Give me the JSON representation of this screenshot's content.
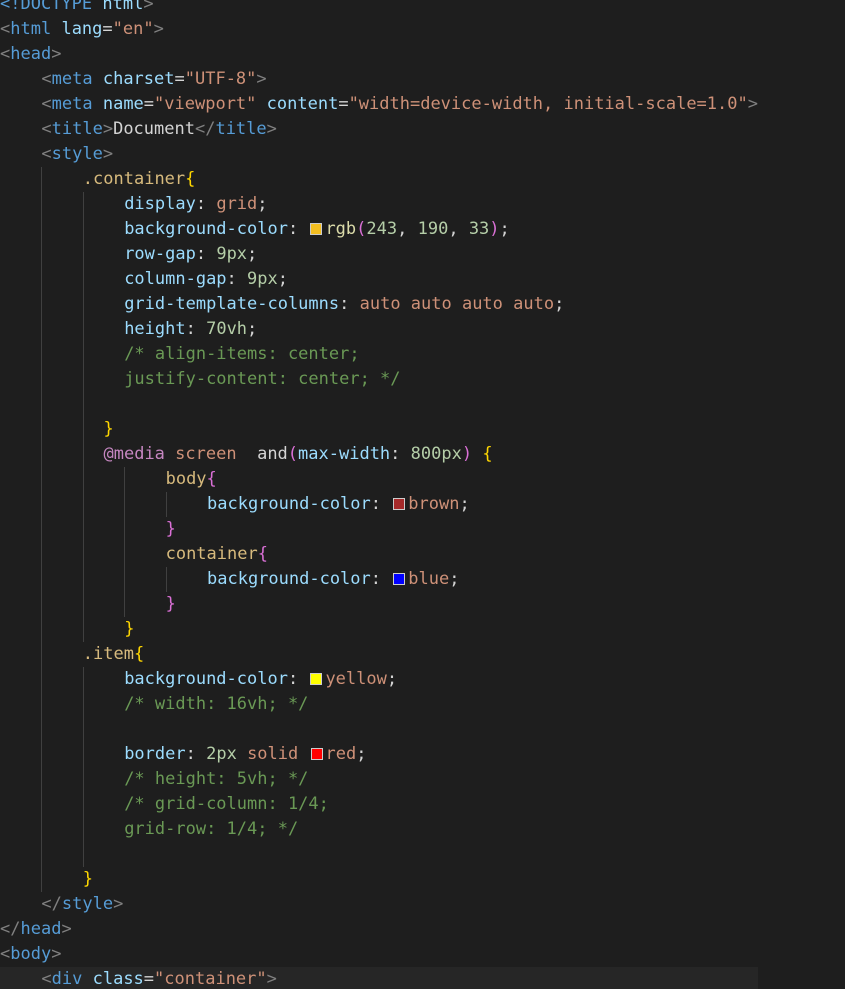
{
  "editor": {
    "language": "html",
    "theme": "dark",
    "current_line": 39,
    "lines": [
      {
        "indent": 0,
        "guides": [],
        "tokens": [
          [
            "<!",
            "tag"
          ],
          [
            "DOCTYPE",
            "tag"
          ],
          [
            " ",
            "text"
          ],
          [
            "html",
            "attr"
          ],
          [
            ">",
            "punc"
          ]
        ]
      },
      {
        "indent": 0,
        "guides": [],
        "tokens": [
          [
            "<",
            "punc"
          ],
          [
            "html",
            "tag"
          ],
          [
            " ",
            "text"
          ],
          [
            "lang",
            "attr"
          ],
          [
            "=",
            "text"
          ],
          [
            "\"en\"",
            "str"
          ],
          [
            ">",
            "punc"
          ]
        ]
      },
      {
        "indent": 0,
        "guides": [],
        "tokens": [
          [
            "<",
            "punc"
          ],
          [
            "head",
            "tag"
          ],
          [
            ">",
            "punc"
          ]
        ]
      },
      {
        "indent": 4,
        "guides": [],
        "tokens": [
          [
            "<",
            "punc"
          ],
          [
            "meta",
            "tag"
          ],
          [
            " ",
            "text"
          ],
          [
            "charset",
            "attr"
          ],
          [
            "=",
            "text"
          ],
          [
            "\"UTF-8\"",
            "str"
          ],
          [
            ">",
            "punc"
          ]
        ]
      },
      {
        "indent": 4,
        "guides": [],
        "tokens": [
          [
            "<",
            "punc"
          ],
          [
            "meta",
            "tag"
          ],
          [
            " ",
            "text"
          ],
          [
            "name",
            "attr"
          ],
          [
            "=",
            "text"
          ],
          [
            "\"viewport\"",
            "str"
          ],
          [
            " ",
            "text"
          ],
          [
            "content",
            "attr"
          ],
          [
            "=",
            "text"
          ],
          [
            "\"width=device-width, initial-scale=1.0\"",
            "str"
          ],
          [
            ">",
            "punc"
          ]
        ]
      },
      {
        "indent": 4,
        "guides": [],
        "tokens": [
          [
            "<",
            "punc"
          ],
          [
            "title",
            "tag"
          ],
          [
            ">",
            "punc"
          ],
          [
            "Document",
            "text"
          ],
          [
            "</",
            "punc"
          ],
          [
            "title",
            "tag"
          ],
          [
            ">",
            "punc"
          ]
        ]
      },
      {
        "indent": 4,
        "guides": [],
        "tokens": [
          [
            "<",
            "punc"
          ],
          [
            "style",
            "tag"
          ],
          [
            ">",
            "punc"
          ]
        ]
      },
      {
        "indent": 8,
        "guides": [
          4
        ],
        "tokens": [
          [
            ".container",
            "sel"
          ],
          [
            "{",
            "b1"
          ]
        ]
      },
      {
        "indent": 12,
        "guides": [
          4,
          8
        ],
        "tokens": [
          [
            "display",
            "prop"
          ],
          [
            ": ",
            "text"
          ],
          [
            "grid",
            "val"
          ],
          [
            ";",
            "text"
          ]
        ]
      },
      {
        "indent": 12,
        "guides": [
          4,
          8
        ],
        "tokens": [
          [
            "background-color",
            "prop"
          ],
          [
            ": ",
            "text"
          ],
          [
            "#f3be21",
            "swatch"
          ],
          [
            "rgb",
            "fn"
          ],
          [
            "(",
            "b2"
          ],
          [
            "243",
            "num"
          ],
          [
            ", ",
            "text"
          ],
          [
            "190",
            "num"
          ],
          [
            ", ",
            "text"
          ],
          [
            "33",
            "num"
          ],
          [
            ")",
            "b2"
          ],
          [
            ";",
            "text"
          ]
        ]
      },
      {
        "indent": 12,
        "guides": [
          4,
          8
        ],
        "tokens": [
          [
            "row-gap",
            "prop"
          ],
          [
            ": ",
            "text"
          ],
          [
            "9px",
            "num"
          ],
          [
            ";",
            "text"
          ]
        ]
      },
      {
        "indent": 12,
        "guides": [
          4,
          8
        ],
        "tokens": [
          [
            "column-gap",
            "prop"
          ],
          [
            ": ",
            "text"
          ],
          [
            "9px",
            "num"
          ],
          [
            ";",
            "text"
          ]
        ]
      },
      {
        "indent": 12,
        "guides": [
          4,
          8
        ],
        "tokens": [
          [
            "grid-template-columns",
            "prop"
          ],
          [
            ": ",
            "text"
          ],
          [
            "auto auto auto auto",
            "val"
          ],
          [
            ";",
            "text"
          ]
        ]
      },
      {
        "indent": 12,
        "guides": [
          4,
          8
        ],
        "tokens": [
          [
            "height",
            "prop"
          ],
          [
            ": ",
            "text"
          ],
          [
            "70vh",
            "num"
          ],
          [
            ";",
            "text"
          ]
        ]
      },
      {
        "indent": 12,
        "guides": [
          4,
          8
        ],
        "tokens": [
          [
            "/* align-items: center;",
            "com"
          ]
        ]
      },
      {
        "indent": 12,
        "guides": [
          4,
          8
        ],
        "tokens": [
          [
            "justify-content: center; */",
            "com"
          ]
        ]
      },
      {
        "indent": 0,
        "guides": [
          4,
          8
        ],
        "tokens": []
      },
      {
        "indent": 10,
        "guides": [
          4,
          8
        ],
        "tokens": [
          [
            "}",
            "b1"
          ]
        ]
      },
      {
        "indent": 10,
        "guides": [
          4,
          8
        ],
        "tokens": [
          [
            "@media",
            "at"
          ],
          [
            " ",
            "text"
          ],
          [
            "screen",
            "val"
          ],
          [
            "  ",
            "text"
          ],
          [
            "and",
            "text"
          ],
          [
            "(",
            "b2"
          ],
          [
            "max-width",
            "prop"
          ],
          [
            ": ",
            "text"
          ],
          [
            "800px",
            "num"
          ],
          [
            ")",
            "b2"
          ],
          [
            " ",
            "text"
          ],
          [
            "{",
            "b1"
          ]
        ]
      },
      {
        "indent": 16,
        "guides": [
          4,
          8,
          12
        ],
        "tokens": [
          [
            "body",
            "sel"
          ],
          [
            "{",
            "b2"
          ]
        ]
      },
      {
        "indent": 20,
        "guides": [
          4,
          8,
          12,
          16
        ],
        "tokens": [
          [
            "background-color",
            "prop"
          ],
          [
            ": ",
            "text"
          ],
          [
            "#a52a2a",
            "swatch"
          ],
          [
            "brown",
            "val"
          ],
          [
            ";",
            "text"
          ]
        ]
      },
      {
        "indent": 16,
        "guides": [
          4,
          8,
          12
        ],
        "tokens": [
          [
            "}",
            "b2"
          ]
        ]
      },
      {
        "indent": 16,
        "guides": [
          4,
          8,
          12
        ],
        "tokens": [
          [
            "container",
            "sel"
          ],
          [
            "{",
            "b2"
          ]
        ]
      },
      {
        "indent": 20,
        "guides": [
          4,
          8,
          12,
          16
        ],
        "tokens": [
          [
            "background-color",
            "prop"
          ],
          [
            ": ",
            "text"
          ],
          [
            "#0000ff",
            "swatch"
          ],
          [
            "blue",
            "val"
          ],
          [
            ";",
            "text"
          ]
        ]
      },
      {
        "indent": 16,
        "guides": [
          4,
          8,
          12
        ],
        "tokens": [
          [
            "}",
            "b2"
          ]
        ]
      },
      {
        "indent": 12,
        "guides": [
          4,
          8
        ],
        "tokens": [
          [
            "}",
            "b1"
          ]
        ]
      },
      {
        "indent": 8,
        "guides": [
          4
        ],
        "tokens": [
          [
            ".item",
            "sel"
          ],
          [
            "{",
            "b1"
          ]
        ]
      },
      {
        "indent": 12,
        "guides": [
          4,
          8
        ],
        "tokens": [
          [
            "background-color",
            "prop"
          ],
          [
            ": ",
            "text"
          ],
          [
            "#ffff00",
            "swatch"
          ],
          [
            "yellow",
            "val"
          ],
          [
            ";",
            "text"
          ]
        ]
      },
      {
        "indent": 12,
        "guides": [
          4,
          8
        ],
        "tokens": [
          [
            "/* width: 16vh; */",
            "com"
          ]
        ]
      },
      {
        "indent": 0,
        "guides": [
          4,
          8
        ],
        "tokens": []
      },
      {
        "indent": 12,
        "guides": [
          4,
          8
        ],
        "tokens": [
          [
            "border",
            "prop"
          ],
          [
            ": ",
            "text"
          ],
          [
            "2px",
            "num"
          ],
          [
            " ",
            "text"
          ],
          [
            "solid",
            "val"
          ],
          [
            " ",
            "text"
          ],
          [
            "#ff0000",
            "swatch"
          ],
          [
            "red",
            "val"
          ],
          [
            ";",
            "text"
          ]
        ]
      },
      {
        "indent": 12,
        "guides": [
          4,
          8
        ],
        "tokens": [
          [
            "/* height: 5vh; */",
            "com"
          ]
        ]
      },
      {
        "indent": 12,
        "guides": [
          4,
          8
        ],
        "tokens": [
          [
            "/* grid-column: 1/4;",
            "com"
          ]
        ]
      },
      {
        "indent": 12,
        "guides": [
          4,
          8
        ],
        "tokens": [
          [
            "grid-row: 1/4; */",
            "com"
          ]
        ]
      },
      {
        "indent": 0,
        "guides": [
          4,
          8
        ],
        "tokens": []
      },
      {
        "indent": 8,
        "guides": [
          4
        ],
        "tokens": [
          [
            "}",
            "b1"
          ]
        ]
      },
      {
        "indent": 4,
        "guides": [],
        "tokens": [
          [
            "</",
            "punc"
          ],
          [
            "style",
            "tag"
          ],
          [
            ">",
            "punc"
          ]
        ]
      },
      {
        "indent": 0,
        "guides": [],
        "tokens": [
          [
            "</",
            "punc"
          ],
          [
            "head",
            "tag"
          ],
          [
            ">",
            "punc"
          ]
        ]
      },
      {
        "indent": 0,
        "guides": [],
        "tokens": [
          [
            "<",
            "punc"
          ],
          [
            "body",
            "tag"
          ],
          [
            ">",
            "punc"
          ]
        ]
      },
      {
        "indent": 4,
        "guides": [],
        "tokens": [
          [
            "<",
            "punc"
          ],
          [
            "div",
            "tag"
          ],
          [
            " ",
            "text"
          ],
          [
            "class",
            "attr"
          ],
          [
            "=",
            "text"
          ],
          [
            "\"container\"",
            "str"
          ],
          [
            ">",
            "punc"
          ]
        ]
      }
    ]
  }
}
